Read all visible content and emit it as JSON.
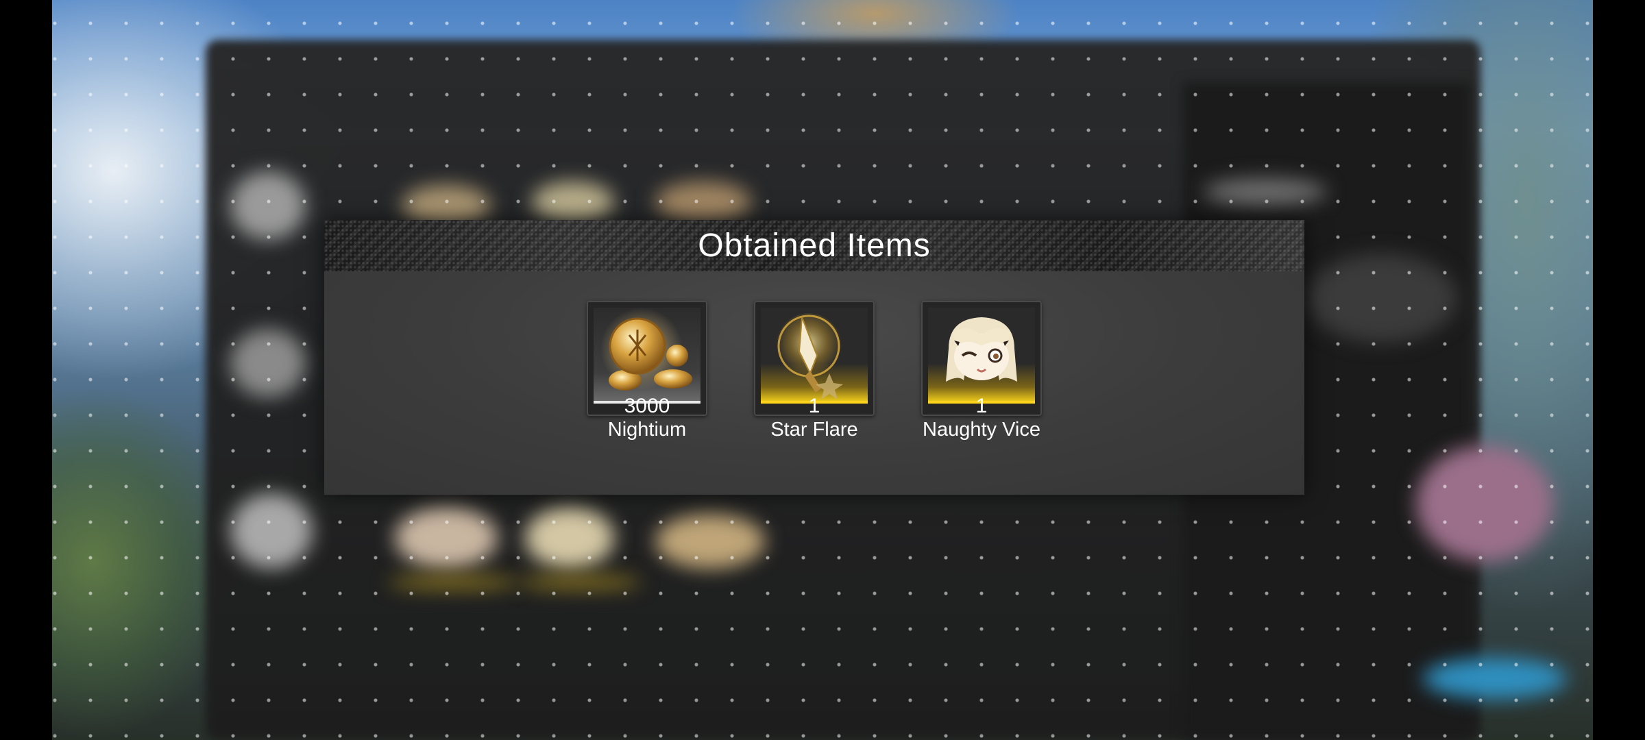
{
  "modal": {
    "title": "Obtained Items"
  },
  "items": [
    {
      "name": "Nightium",
      "quantity": "3000",
      "icon": "gold-coins-icon",
      "rarity_color": "#e8e8e8"
    },
    {
      "name": "Star Flare",
      "quantity": "1",
      "icon": "star-flare-weapon-icon",
      "rarity_color": "#ffd21c"
    },
    {
      "name": "Naughty Vice",
      "quantity": "1",
      "icon": "chibi-character-face-icon",
      "rarity_color": "#ffd21c"
    }
  ]
}
